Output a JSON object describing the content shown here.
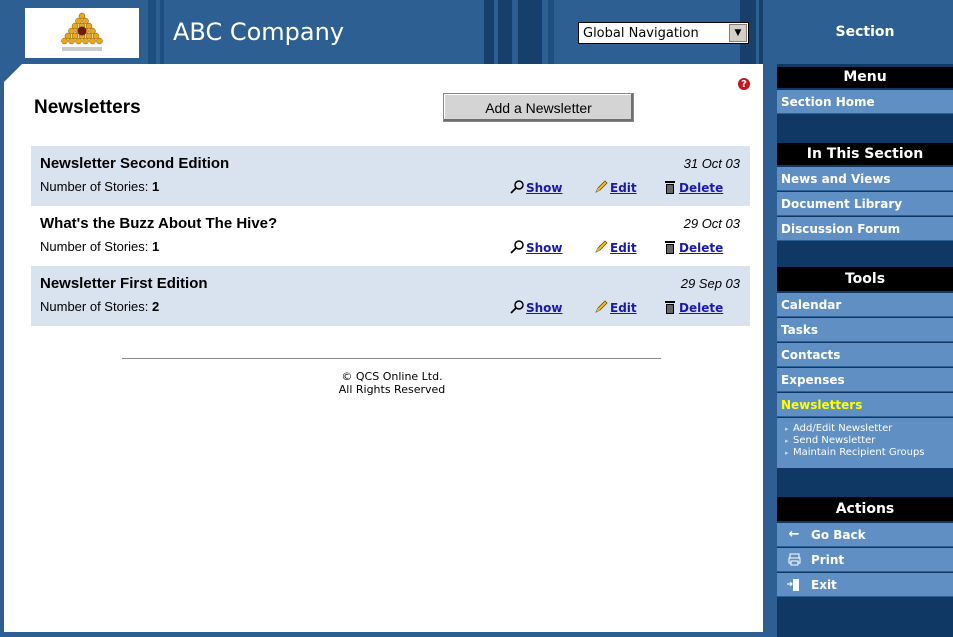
{
  "header": {
    "company": "ABC Company",
    "global_nav_selected": "Global Navigation"
  },
  "page": {
    "title": "Newsletters",
    "add_button": "Add a Newsletter",
    "help_icon_text": "?"
  },
  "newsletters": [
    {
      "title": "Newsletter Second Edition",
      "stories_label": "Number of Stories:",
      "stories": "1",
      "date": "31 Oct 03"
    },
    {
      "title": "What's the Buzz About The Hive?",
      "stories_label": "Number of Stories:",
      "stories": "1",
      "date": "29 Oct 03"
    },
    {
      "title": "Newsletter First Edition",
      "stories_label": "Number of Stories:",
      "stories": "2",
      "date": "29 Sep 03"
    }
  ],
  "row_actions": {
    "show": "Show",
    "edit": "Edit",
    "delete": "Delete"
  },
  "footer": {
    "line1": "© QCS Online Ltd.",
    "line2": "All Rights Reserved"
  },
  "sidebar": {
    "section": "Section",
    "menu_head": "Menu",
    "menu_items": [
      "Section Home"
    ],
    "in_section_head": "In This Section",
    "in_section_items": [
      "News and Views",
      "Document Library",
      "Discussion Forum"
    ],
    "tools_head": "Tools",
    "tools_items": [
      "Calendar",
      "Tasks",
      "Contacts",
      "Expenses",
      "Newsletters"
    ],
    "newsletter_sub": [
      "Add/Edit Newsletter",
      "Send Newsletter",
      "Maintain Recipient Groups"
    ],
    "actions_head": "Actions",
    "actions": [
      "Go Back",
      "Print",
      "Exit"
    ]
  },
  "colors": {
    "header_blue": "#2d5f92",
    "sidebar_navy": "#0f3864",
    "sidebar_item": "#5f8fc3",
    "row_shade": "#d9e3ef",
    "active_item": "#ffff00",
    "link": "#1a1aa8"
  }
}
